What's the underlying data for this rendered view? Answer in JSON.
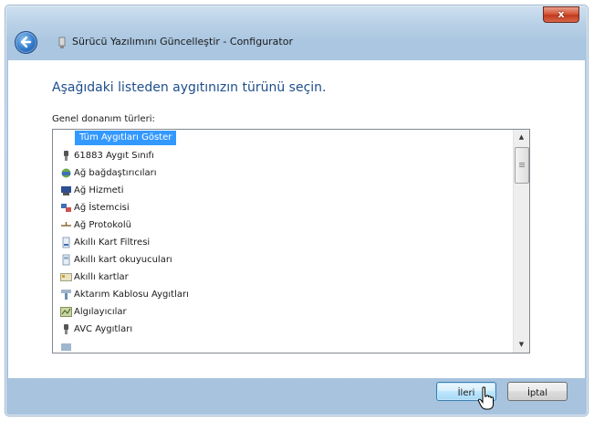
{
  "window": {
    "close_label": "x",
    "title": "Sürücü Yazılımını Güncelleştir - Configurator"
  },
  "main": {
    "heading": "Aşağıdaki listeden aygıtınızın türünü seçin.",
    "list_label": "Genel donanım türleri:",
    "items": [
      {
        "label": "Tüm Aygıtları Göster",
        "icon": "none",
        "selected": true
      },
      {
        "label": "61883 Aygıt Sınıfı",
        "icon": "plug-icon"
      },
      {
        "label": "Ağ bağdaştırıcıları",
        "icon": "network-adapter-icon"
      },
      {
        "label": "Ağ Hizmeti",
        "icon": "network-service-icon"
      },
      {
        "label": "Ağ İstemcisi",
        "icon": "network-client-icon"
      },
      {
        "label": "Ağ Protokolü",
        "icon": "network-protocol-icon"
      },
      {
        "label": "Akıllı Kart Filtresi",
        "icon": "smart-card-filter-icon"
      },
      {
        "label": "Akıllı kart okuyucuları",
        "icon": "smart-card-reader-icon"
      },
      {
        "label": "Akıllı kartlar",
        "icon": "smart-card-icon"
      },
      {
        "label": "Aktarım Kablosu Aygıtları",
        "icon": "transfer-cable-icon"
      },
      {
        "label": "Algılayıcılar",
        "icon": "sensor-icon"
      },
      {
        "label": "AVC Aygıtları",
        "icon": "plug-icon"
      }
    ]
  },
  "buttons": {
    "next": "İleri",
    "cancel": "İptal"
  },
  "colors": {
    "selection": "#3399ff",
    "heading": "#1e4e8c",
    "frame": "#a7c3de"
  }
}
